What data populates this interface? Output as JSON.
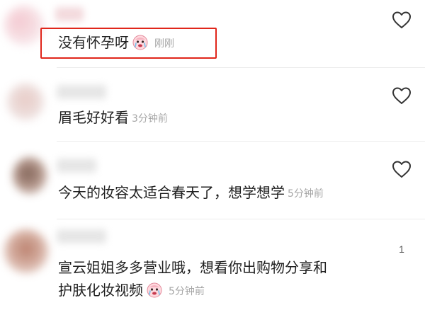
{
  "comments": [
    {
      "text": "没有怀孕呀",
      "time": "刚刚",
      "has_emoji": true,
      "likes": ""
    },
    {
      "text": "眉毛好好看",
      "time": "3分钟前",
      "has_emoji": false,
      "likes": ""
    },
    {
      "text": "今天的妆容太适合春天了，想学想学",
      "time": "5分钟前",
      "has_emoji": false,
      "likes": ""
    },
    {
      "text_line1": "宣云姐姐多多营业哦，想看你出购物分享和",
      "text_line2": "护肤化妆视频",
      "time": "5分钟前",
      "has_emoji": true,
      "likes": "1"
    }
  ],
  "colors": {
    "highlight": "#e0261b",
    "text": "#1f1f1f",
    "time": "#a6a6a6"
  },
  "icons": {
    "like": "heart-outline-icon",
    "emoji": "crying-face-emoji"
  }
}
